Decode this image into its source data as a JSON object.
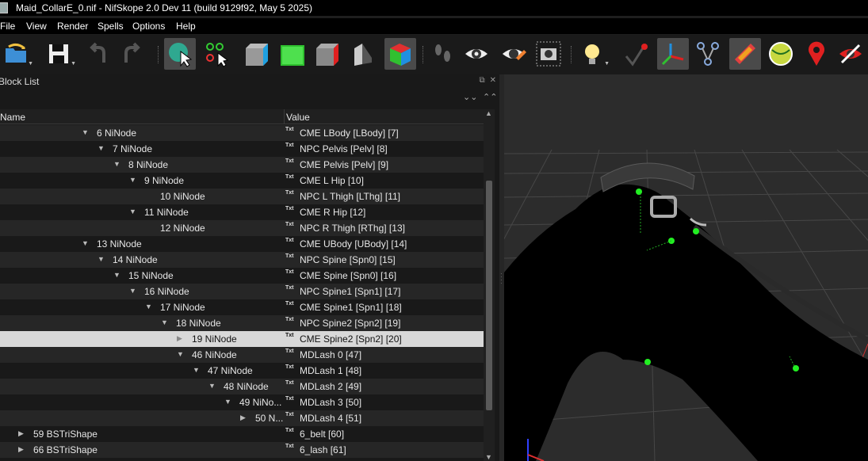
{
  "window": {
    "title": "Maid_CollarE_0.nif - NifSkope 2.0 Dev 11 (build 9129f92, May  5 2025)"
  },
  "menu": [
    "File",
    "View",
    "Render",
    "Spells",
    "Options",
    "Help"
  ],
  "toolbar": [
    {
      "icon": "load-icon"
    },
    {
      "icon": "save-icon"
    },
    {
      "icon": "undo-icon"
    },
    {
      "icon": "redo-icon"
    },
    {
      "icon": "select-object-icon",
      "active": true
    },
    {
      "icon": "select-vertex-icon"
    },
    {
      "icon": "view-front-icon"
    },
    {
      "icon": "view-side-icon"
    },
    {
      "icon": "view-back-icon"
    },
    {
      "icon": "view-user-icon"
    },
    {
      "icon": "view-perspective-icon",
      "active": true
    },
    {
      "icon": "walk-mode-icon"
    },
    {
      "icon": "show-hidden-icon"
    },
    {
      "icon": "show-marker-icon"
    },
    {
      "icon": "screenshot-icon"
    },
    {
      "icon": "lighting-icon"
    },
    {
      "icon": "show-vertices-icon"
    },
    {
      "icon": "show-axes-icon",
      "active": true
    },
    {
      "icon": "show-nodes-icon"
    },
    {
      "icon": "show-textures-icon",
      "active": true
    },
    {
      "icon": "show-collision-icon"
    },
    {
      "icon": "show-markers-pin-icon"
    },
    {
      "icon": "hide-icon"
    }
  ],
  "block_list": {
    "title": "Block List",
    "columns": {
      "name": "Name",
      "value": "Value"
    },
    "txt_badge": "Txt",
    "rows": [
      {
        "indent": 1,
        "expanded": true,
        "name": "6 NiNode",
        "value": "CME LBody [LBody] [7]"
      },
      {
        "indent": 2,
        "expanded": true,
        "name": "7 NiNode",
        "value": "NPC Pelvis [Pelv] [8]"
      },
      {
        "indent": 3,
        "expanded": true,
        "name": "8 NiNode",
        "value": "CME Pelvis [Pelv] [9]"
      },
      {
        "indent": 4,
        "expanded": true,
        "name": "9 NiNode",
        "value": "CME L Hip [10]"
      },
      {
        "indent": 5,
        "expanded": null,
        "name": "10 NiNode",
        "value": "NPC L Thigh [LThg] [11]"
      },
      {
        "indent": 4,
        "expanded": true,
        "name": "11 NiNode",
        "value": "CME R Hip [12]"
      },
      {
        "indent": 5,
        "expanded": null,
        "name": "12 NiNode",
        "value": "NPC R Thigh [RThg] [13]"
      },
      {
        "indent": 1,
        "expanded": true,
        "name": "13 NiNode",
        "value": "CME UBody [UBody] [14]"
      },
      {
        "indent": 2,
        "expanded": true,
        "name": "14 NiNode",
        "value": "NPC Spine [Spn0] [15]"
      },
      {
        "indent": 3,
        "expanded": true,
        "name": "15 NiNode",
        "value": "CME Spine [Spn0] [16]"
      },
      {
        "indent": 4,
        "expanded": true,
        "name": "16 NiNode",
        "value": "NPC Spine1 [Spn1] [17]"
      },
      {
        "indent": 5,
        "expanded": true,
        "name": "17 NiNode",
        "value": "CME Spine1 [Spn1] [18]"
      },
      {
        "indent": 6,
        "expanded": true,
        "name": "18 NiNode",
        "value": "NPC Spine2 [Spn2] [19]"
      },
      {
        "indent": 7,
        "expanded": false,
        "name": "19 NiNode",
        "value": "CME Spine2 [Spn2] [20]",
        "selected": true
      },
      {
        "indent": 7,
        "expanded": true,
        "name": "46 NiNode",
        "value": "MDLash 0 [47]"
      },
      {
        "indent": 8,
        "expanded": true,
        "name": "47 NiNode",
        "value": "MDLash 1 [48]"
      },
      {
        "indent": 9,
        "expanded": true,
        "name": "48 NiNode",
        "value": "MDLash 2 [49]"
      },
      {
        "indent": 10,
        "expanded": true,
        "name": "49 NiNo...",
        "value": "MDLash 3 [50]"
      },
      {
        "indent": 11,
        "expanded": false,
        "name": "50 N...",
        "value": "MDLash 4 [51]"
      },
      {
        "indent": -3,
        "expanded": false,
        "name": "59 BSTriShape",
        "value": "6_belt [60]"
      },
      {
        "indent": -3,
        "expanded": false,
        "name": "66 BSTriShape",
        "value": "6_lash [61]"
      }
    ]
  },
  "viewport": {
    "background": "#2c2c2c",
    "grid_color": "#4a4a4a",
    "model_color": "#000000",
    "node_color": "#22ee22"
  }
}
